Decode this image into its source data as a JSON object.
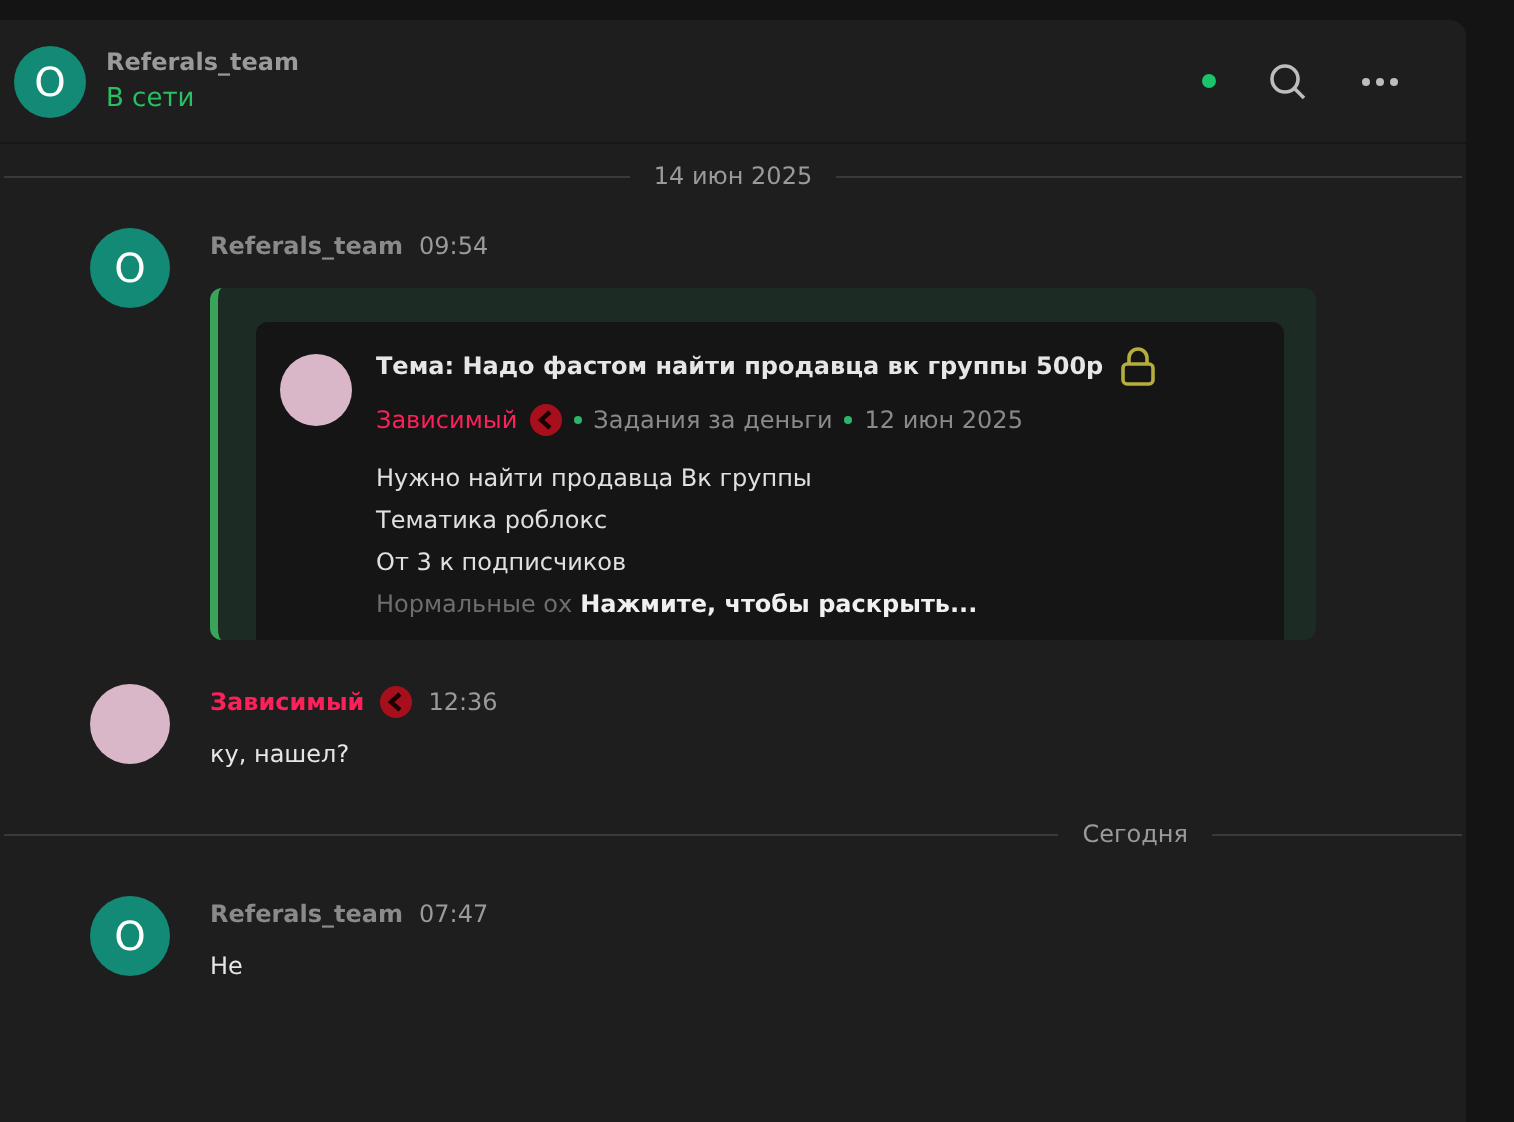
{
  "header": {
    "avatar_letter": "O",
    "name": "Referals_team",
    "status": "В сети",
    "online": true
  },
  "feed": [
    {
      "kind": "separator",
      "label": "14 июн 2025"
    },
    {
      "kind": "message",
      "avatar": {
        "kind": "letter",
        "letter": "O"
      },
      "author": "Referals_team",
      "color": "#8a8a8a",
      "badge": false,
      "time": "09:54",
      "quote": {
        "title": "Тема: Надо фастом найти продавца вк группы 500р",
        "locked": true,
        "author": "Зависимый",
        "category": "Задания за деньги",
        "date": "12 июн 2025",
        "lines": [
          "Нужно найти продавца Вк группы",
          "Тематика роблокс",
          "От 3 к подписчиков"
        ],
        "faded_line": "Нормальные ох",
        "expand": "Нажмите, чтобы раскрыть..."
      }
    },
    {
      "kind": "message",
      "avatar": {
        "kind": "photo"
      },
      "author": "Зависимый",
      "color": "#ff1f5a",
      "badge": true,
      "time": "12:36",
      "text": "ку, нашел?"
    },
    {
      "kind": "separator",
      "label": "Сегодня"
    },
    {
      "kind": "message",
      "avatar": {
        "kind": "letter",
        "letter": "O"
      },
      "author": "Referals_team",
      "color": "#8a8a8a",
      "badge": false,
      "time": "07:47",
      "text": "Не"
    }
  ]
}
